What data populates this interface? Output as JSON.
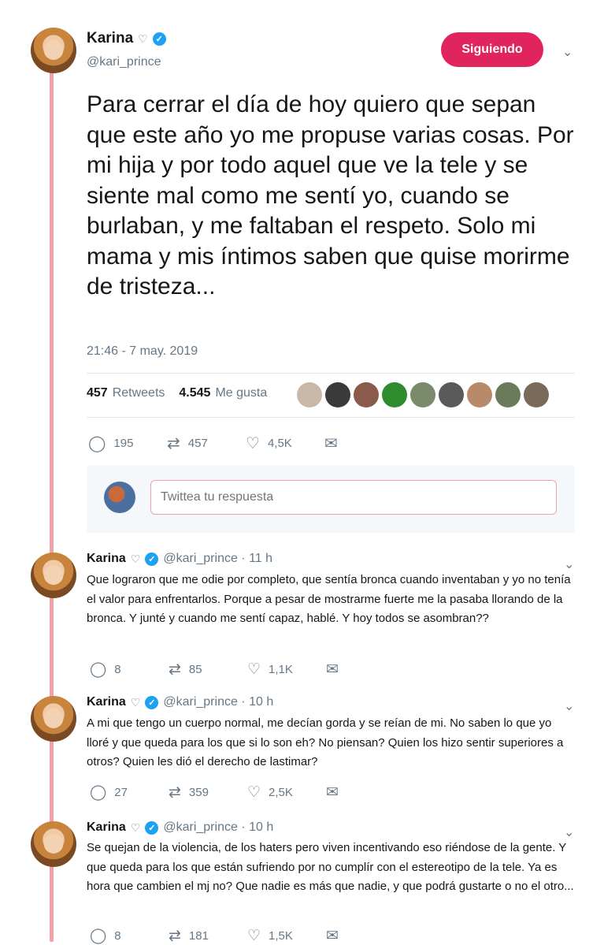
{
  "main_tweet": {
    "author_name": "Karina",
    "author_handle": "@kari_prince",
    "follow_button": "Siguiendo",
    "text": "Para cerrar el día de hoy quiero que sepan que este año yo me propuse varias cosas. Por mi hija y por todo aquel que ve la tele y se siente mal como me sentí yo, cuando  se burlaban, y me faltaban el respeto. Solo mi mama y mis íntimos saben que quise morirme de tristeza...",
    "timestamp": "21:46 - 7 may. 2019",
    "retweets_count": "457",
    "retweets_label": "Retweets",
    "likes_count": "4.545",
    "likes_label": "Me gusta",
    "replies": "195",
    "rts": "457",
    "likes": "4,5K"
  },
  "reply_composer": {
    "placeholder": "Twittea tu respuesta"
  },
  "thread": [
    {
      "name": "Karina",
      "handle_time": "@kari_prince · 11 h",
      "text": "Que lograron que me odie por completo, que sentía bronca cuando inventaban y yo no tenía el valor para enfrentarlos. Porque a pesar de mostrarme fuerte me la pasaba llorando de la bronca. Y junté y cuando me sentí capaz, hablé. Y hoy todos se asombran??",
      "replies": "8",
      "retweets": "85",
      "likes": "1,1K"
    },
    {
      "name": "Karina",
      "handle_time": "@kari_prince · 10 h",
      "text": "A mi que tengo un cuerpo normal, me decían gorda y se reían de mi. No saben lo que yo lloré y que queda para los que si lo son eh? No piensan? Quien los hizo sentir superiores a otros? Quien les dió el derecho de lastimar?",
      "replies": "27",
      "retweets": "359",
      "likes": "2,5K"
    },
    {
      "name": "Karina",
      "handle_time": "@kari_prince · 10 h",
      "text": "Se quejan de la violencia, de los haters pero viven incentivando eso riéndose de la gente. Y que queda para los que están sufriendo por no cumplír con el estereotipo de la tele. Ya es hora que cambien el mj no? Que nadie es más que nadie, y que podrá gustarte o no el otro...",
      "replies": "8",
      "retweets": "181",
      "likes": "1,5K"
    }
  ],
  "icons": {
    "reply": "speech-bubble-icon",
    "retweet": "retweet-icon",
    "like": "heart-icon",
    "message": "envelope-icon"
  },
  "colors": {
    "accent": "#e0245e",
    "verified": "#1da1f2",
    "thread_line": "#f2a0a8"
  }
}
